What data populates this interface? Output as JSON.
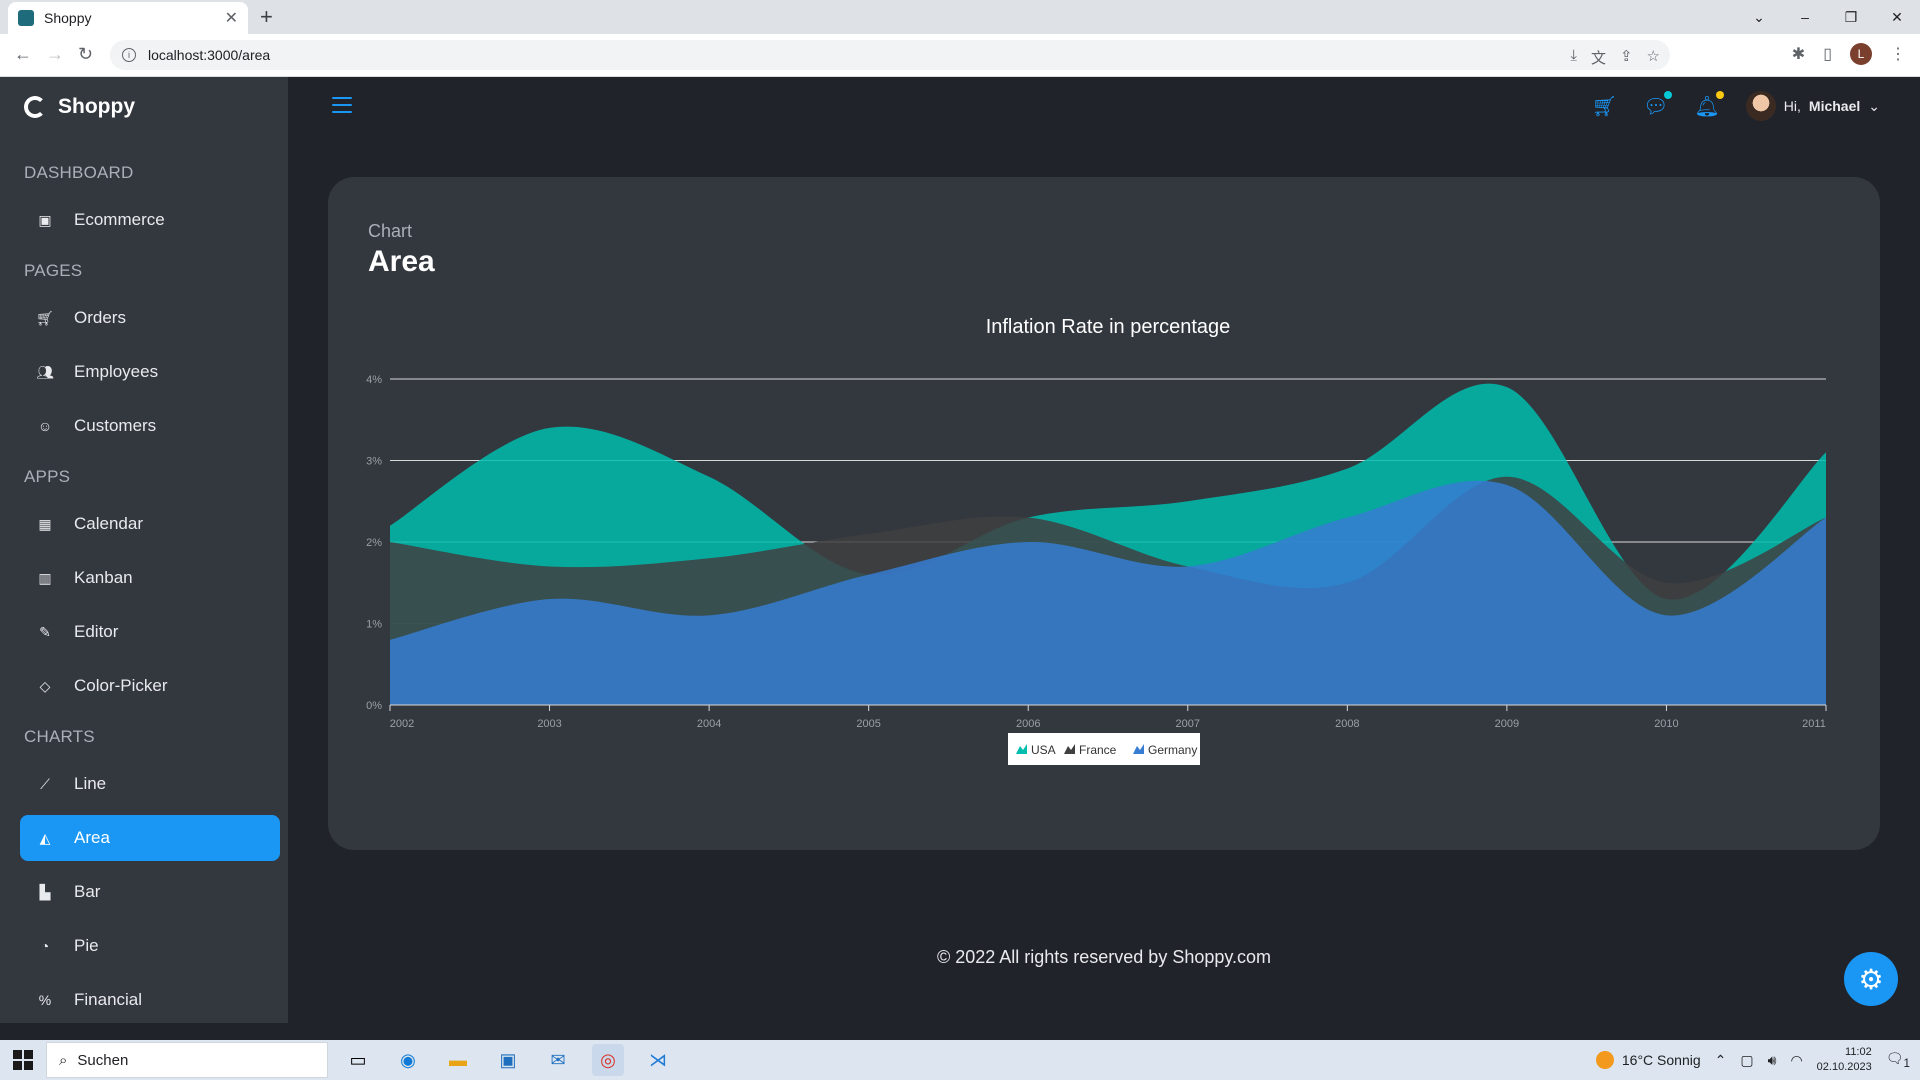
{
  "browser": {
    "tab_title": "Shoppy",
    "url": "localhost:3000/area",
    "profile_initial": "L"
  },
  "sidebar": {
    "brand": "Shoppy",
    "sections": [
      {
        "title": "DASHBOARD",
        "items": [
          {
            "label": "Ecommerce",
            "icon": "shopping-bag-icon"
          }
        ]
      },
      {
        "title": "PAGES",
        "items": [
          {
            "label": "Orders",
            "icon": "cart-icon"
          },
          {
            "label": "Employees",
            "icon": "employees-icon"
          },
          {
            "label": "Customers",
            "icon": "customers-icon"
          }
        ]
      },
      {
        "title": "APPS",
        "items": [
          {
            "label": "Calendar",
            "icon": "calendar-icon"
          },
          {
            "label": "Kanban",
            "icon": "kanban-icon"
          },
          {
            "label": "Editor",
            "icon": "edit-icon"
          },
          {
            "label": "Color-Picker",
            "icon": "color-picker-icon"
          }
        ]
      },
      {
        "title": "CHARTS",
        "items": [
          {
            "label": "Line",
            "icon": "line-chart-icon"
          },
          {
            "label": "Area",
            "icon": "area-chart-icon",
            "active": true
          },
          {
            "label": "Bar",
            "icon": "bar-chart-icon"
          },
          {
            "label": "Pie",
            "icon": "pie-chart-icon"
          },
          {
            "label": "Financial",
            "icon": "financial-icon"
          }
        ]
      }
    ]
  },
  "topbar": {
    "greeting": "Hi,",
    "user_name": "Michael",
    "chat_dot_color": "#03c9d7",
    "notification_dot_color": "#fec90f"
  },
  "card": {
    "category": "Chart",
    "title": "Area"
  },
  "chart_data": {
    "type": "area",
    "title": "Inflation Rate in percentage",
    "xlabel": "",
    "ylabel": "",
    "x": [
      "2002",
      "2003",
      "2004",
      "2005",
      "2006",
      "2007",
      "2008",
      "2009",
      "2010",
      "2011"
    ],
    "y_ticks": [
      "0%",
      "1%",
      "2%",
      "3%",
      "4%"
    ],
    "ylim": [
      0,
      4
    ],
    "grid": true,
    "legend": "bottom-center",
    "series": [
      {
        "name": "USA",
        "color": "#00bdae",
        "values": [
          2.2,
          3.4,
          2.8,
          1.6,
          2.3,
          2.5,
          2.9,
          3.9,
          1.3,
          3.1
        ]
      },
      {
        "name": "France",
        "color": "#404041",
        "values": [
          2.0,
          1.7,
          1.8,
          2.1,
          2.3,
          1.7,
          1.5,
          2.8,
          1.5,
          2.3
        ]
      },
      {
        "name": "Germany",
        "color": "#357cd2",
        "values": [
          0.8,
          1.3,
          1.1,
          1.6,
          2.0,
          1.7,
          2.3,
          2.7,
          1.1,
          2.3
        ]
      }
    ]
  },
  "footer": {
    "text": "© 2022 All rights reserved by Shoppy.com"
  },
  "taskbar": {
    "search_placeholder": "Suchen",
    "weather": "16°C  Sonnig",
    "time": "11:02",
    "date": "02.10.2023",
    "notifications": "1"
  }
}
